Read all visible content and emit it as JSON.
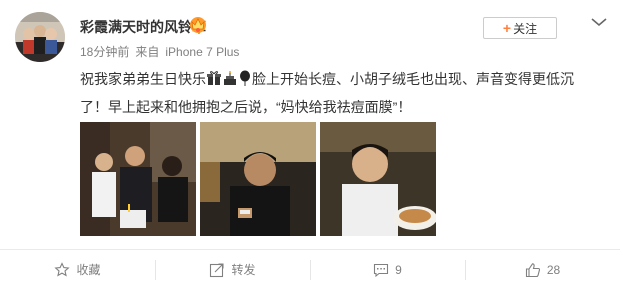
{
  "post": {
    "author_name": "彩霞满天时的风铃草",
    "time": "18分钟前",
    "source_prefix": "来自",
    "source_device": "iPhone 7 Plus",
    "text_part1": "祝我家弟弟生日快乐",
    "text_part2": "脸上开始长痘、小胡子绒毛也出现、声音变得更低沉了！早上起来和他拥抱之后说，“妈快给我祛痘面膜”！"
  },
  "follow": {
    "label": "关注"
  },
  "actions": [
    {
      "label": "收藏",
      "icon": "star-icon"
    },
    {
      "label": "转发",
      "icon": "share-icon"
    },
    {
      "label": "9",
      "icon": "comment-icon"
    },
    {
      "label": "28",
      "icon": "like-icon"
    }
  ],
  "colors": {
    "accent_orange": "#ff8140",
    "meta_gray": "#808080",
    "text": "#333333"
  },
  "icons": [
    "vip-crown-icon",
    "chevron-down-icon",
    "gift-emoji-icon",
    "cake-emoji-icon",
    "balloon-emoji-icon"
  ]
}
